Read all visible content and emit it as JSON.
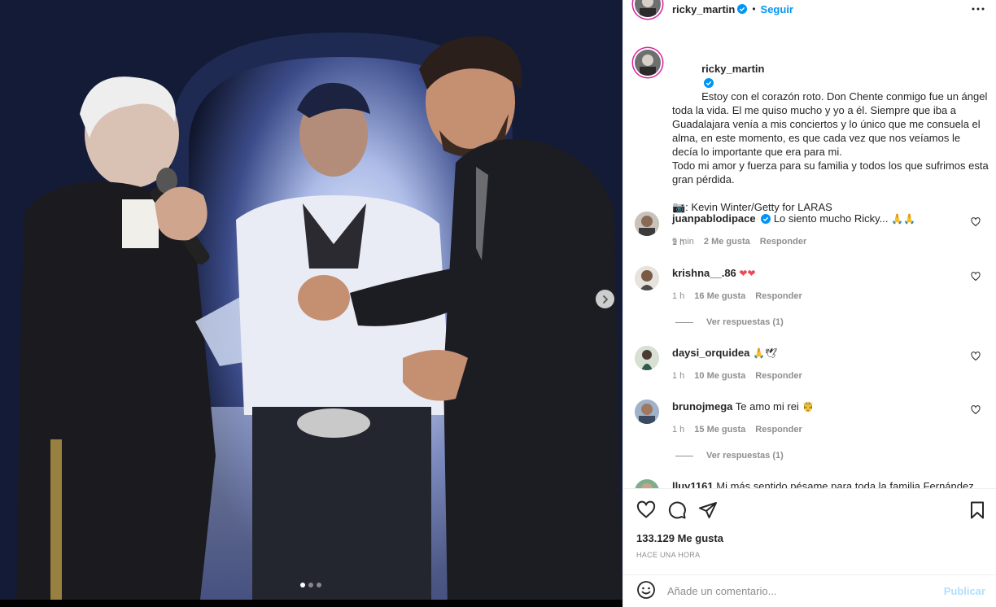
{
  "post": {
    "author": "ricky_martin",
    "follow_label": "Seguir",
    "separator": "•",
    "caption": "Estoy con el corazón roto. Don Chente conmigo fue un ángel toda la vida. El me quiso mucho y yo a él. Siempre que iba a Guadalajara venía a mis conciertos y lo único que me consuela el alma, en este momento, es que cada vez que nos veíamos le decía lo importante que era para mi.\nTodo mi amor y fuerza para su familia y todos los que sufrimos esta gran pérdida.\n\n📷: Kevin Winter/Getty for LARAS",
    "caption_time": "1 h",
    "likes": "133.129 Me gusta",
    "time_ago": "HACE UNA HORA",
    "carousel": {
      "slide_count": 3,
      "active_slide": 1
    }
  },
  "comments": [
    {
      "username": "juanpablodipace",
      "verified": true,
      "text": "Lo siento mucho Ricky...",
      "emoji": "🙏🙏",
      "time": "9 min",
      "likes": "2 Me gusta",
      "reply": "Responder",
      "replies_label": ""
    },
    {
      "username": "krishna__.86",
      "verified": false,
      "text": "",
      "emoji": "❤❤",
      "time": "1 h",
      "likes": "16 Me gusta",
      "reply": "Responder",
      "replies_label": "Ver respuestas (1)"
    },
    {
      "username": "daysi_orquidea",
      "verified": false,
      "text": "",
      "emoji": "🙏🕊",
      "time": "1 h",
      "likes": "10 Me gusta",
      "reply": "Responder",
      "replies_label": ""
    },
    {
      "username": "brunojmega",
      "verified": false,
      "text": "Te amo mi rei",
      "emoji": "🤴",
      "time": "1 h",
      "likes": "15 Me gusta",
      "reply": "Responder",
      "replies_label": "Ver respuestas (1)"
    },
    {
      "username": "lluy1161",
      "verified": false,
      "text": "Mi más sentido pésame para toda la familia Fernández",
      "emoji": "",
      "time": "",
      "likes": "",
      "reply": "",
      "replies_label": ""
    }
  ],
  "composer": {
    "placeholder": "Añade un comentario...",
    "publish_label": "Publicar"
  },
  "icons": {
    "more": "more-horizontal-icon",
    "like": "heart-icon",
    "comment": "comment-icon",
    "share": "paper-plane-icon",
    "save": "bookmark-icon",
    "emoji": "smiley-icon",
    "next": "chevron-right-icon",
    "verified": "verified-badge-icon"
  },
  "colors": {
    "link": "#0095f6",
    "publish_disabled": "#b2dffc",
    "secondary_text": "#8e8e8e",
    "heart_emoji": "#ed4956"
  }
}
